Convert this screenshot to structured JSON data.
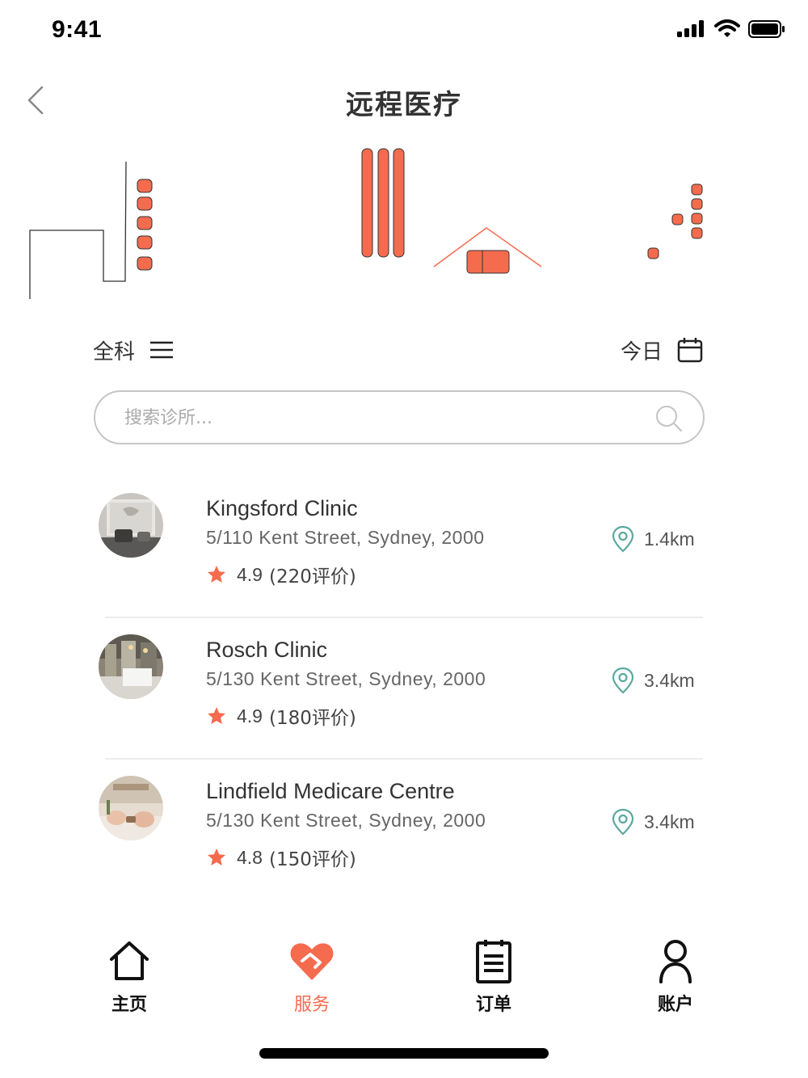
{
  "status_bar": {
    "time": "9:41"
  },
  "nav": {
    "title": "远程医疗"
  },
  "filters": {
    "department": "全科",
    "date": "今日"
  },
  "search": {
    "placeholder": "搜索诊所..."
  },
  "clinics": [
    {
      "name": "Kingsford Clinic",
      "address": "5/110 Kent Street, Sydney, 2000",
      "rating": "4.9",
      "reviews": "(220评价)",
      "distance": "1.4km"
    },
    {
      "name": "Rosch Clinic",
      "address": "5/130 Kent Street, Sydney, 2000",
      "rating": "4.9",
      "reviews": "(180评价)",
      "distance": "3.4km"
    },
    {
      "name": "Lindfield Medicare Centre",
      "address": "5/130 Kent Street, Sydney, 2000",
      "rating": "4.8",
      "reviews": "(150评价)",
      "distance": "3.4km"
    }
  ],
  "tabs": [
    {
      "label": "主页",
      "icon": "home-icon"
    },
    {
      "label": "服务",
      "icon": "heart-hand-icon",
      "active": true
    },
    {
      "label": "订单",
      "icon": "clipboard-icon"
    },
    {
      "label": "账户",
      "icon": "user-icon"
    }
  ],
  "colors": {
    "accent": "#f56b4e",
    "pin": "#5aa8a0",
    "text": "#333333"
  }
}
